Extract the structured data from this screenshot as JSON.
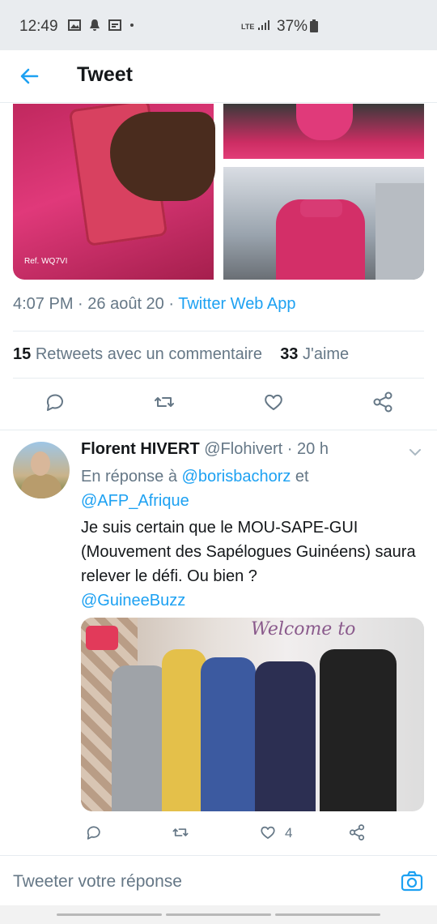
{
  "status_bar": {
    "time": "12:49",
    "network": "LTE",
    "battery": "37%"
  },
  "header": {
    "title": "Tweet"
  },
  "tweet": {
    "media": {
      "watermark": "Ref. WQ7VI"
    },
    "meta": {
      "time": "4:07 PM",
      "date": "26 août 20",
      "source": "Twitter Web App"
    },
    "stats": {
      "retweets_count": "15",
      "retweets_label": "Retweets avec un commentaire",
      "likes_count": "33",
      "likes_label": "J'aime"
    }
  },
  "reply": {
    "author_name": "Florent HIVERT",
    "handle": "@Flohivert",
    "time": "20 h",
    "in_reply_prefix": "En réponse à",
    "in_reply_user1": "@borisbachorz",
    "in_reply_and": "et",
    "in_reply_user2": "@AFP_Afrique",
    "text": "Je suis certain que le MOU-SAPE-GUI (Mouvement des Sapélogues Guinéens) saura relever le défi. Ou bien ?",
    "mention": "@GuineeBuzz",
    "photo_script": "Welcome to",
    "likes": "4"
  },
  "compose": {
    "placeholder": "Tweeter votre réponse"
  },
  "colors": {
    "accent": "#1da1f2",
    "text_secondary": "#657786"
  },
  "icons": {
    "back": "arrow-left-icon",
    "reply": "comment-icon",
    "retweet": "retweet-icon",
    "like": "heart-icon",
    "share": "share-icon",
    "camera": "camera-icon"
  }
}
